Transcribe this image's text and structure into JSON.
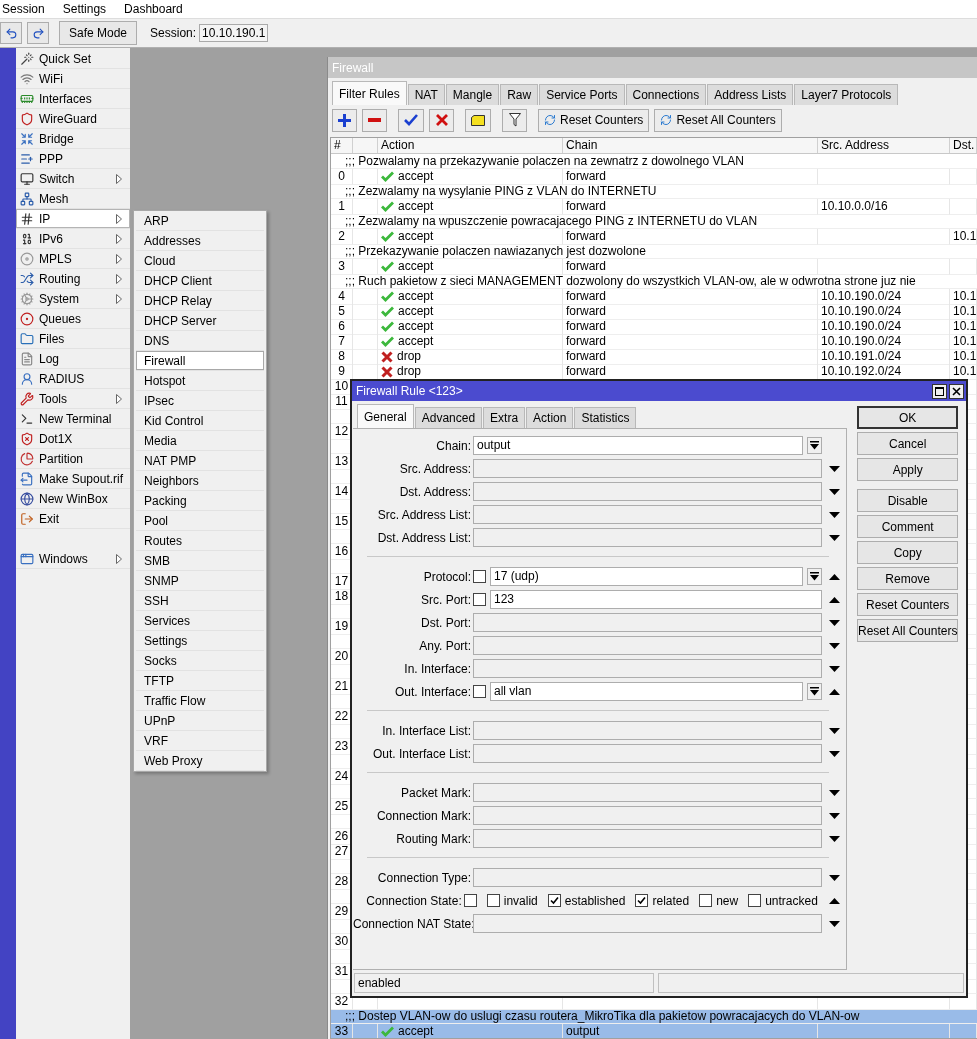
{
  "menu_bar": [
    "Session",
    "Settings",
    "Dashboard"
  ],
  "toolbar": {
    "safe_mode": "Safe Mode",
    "session_label": "Session:",
    "session_value": "10.10.190.1"
  },
  "sidebar": {
    "items": [
      {
        "label": "Quick Set",
        "submenu": false,
        "selected": false
      },
      {
        "label": "WiFi",
        "submenu": false,
        "selected": false
      },
      {
        "label": "Interfaces",
        "submenu": false,
        "selected": false
      },
      {
        "label": "WireGuard",
        "submenu": false,
        "selected": false
      },
      {
        "label": "Bridge",
        "submenu": false,
        "selected": false
      },
      {
        "label": "PPP",
        "submenu": false,
        "selected": false
      },
      {
        "label": "Switch",
        "submenu": true,
        "selected": false
      },
      {
        "label": "Mesh",
        "submenu": false,
        "selected": false
      },
      {
        "label": "IP",
        "submenu": true,
        "selected": true
      },
      {
        "label": "IPv6",
        "submenu": true,
        "selected": false
      },
      {
        "label": "MPLS",
        "submenu": true,
        "selected": false
      },
      {
        "label": "Routing",
        "submenu": true,
        "selected": false
      },
      {
        "label": "System",
        "submenu": true,
        "selected": false
      },
      {
        "label": "Queues",
        "submenu": false,
        "selected": false
      },
      {
        "label": "Files",
        "submenu": false,
        "selected": false
      },
      {
        "label": "Log",
        "submenu": false,
        "selected": false
      },
      {
        "label": "RADIUS",
        "submenu": false,
        "selected": false
      },
      {
        "label": "Tools",
        "submenu": true,
        "selected": false
      },
      {
        "label": "New Terminal",
        "submenu": false,
        "selected": false
      },
      {
        "label": "Dot1X",
        "submenu": false,
        "selected": false
      },
      {
        "label": "Partition",
        "submenu": false,
        "selected": false
      },
      {
        "label": "Make Supout.rif",
        "submenu": false,
        "selected": false
      },
      {
        "label": "New WinBox",
        "submenu": false,
        "selected": false
      },
      {
        "label": "Exit",
        "submenu": false,
        "selected": false
      }
    ],
    "windows_item": {
      "label": "Windows",
      "submenu": true,
      "selected": false
    }
  },
  "submenu": [
    {
      "label": "ARP",
      "selected": false
    },
    {
      "label": "Addresses",
      "selected": false
    },
    {
      "label": "Cloud",
      "selected": false
    },
    {
      "label": "DHCP Client",
      "selected": false
    },
    {
      "label": "DHCP Relay",
      "selected": false
    },
    {
      "label": "DHCP Server",
      "selected": false
    },
    {
      "label": "DNS",
      "selected": false
    },
    {
      "label": "Firewall",
      "selected": true
    },
    {
      "label": "Hotspot",
      "selected": false
    },
    {
      "label": "IPsec",
      "selected": false
    },
    {
      "label": "Kid Control",
      "selected": false
    },
    {
      "label": "Media",
      "selected": false
    },
    {
      "label": "NAT PMP",
      "selected": false
    },
    {
      "label": "Neighbors",
      "selected": false
    },
    {
      "label": "Packing",
      "selected": false
    },
    {
      "label": "Pool",
      "selected": false
    },
    {
      "label": "Routes",
      "selected": false
    },
    {
      "label": "SMB",
      "selected": false
    },
    {
      "label": "SNMP",
      "selected": false
    },
    {
      "label": "SSH",
      "selected": false
    },
    {
      "label": "Services",
      "selected": false
    },
    {
      "label": "Settings",
      "selected": false
    },
    {
      "label": "Socks",
      "selected": false
    },
    {
      "label": "TFTP",
      "selected": false
    },
    {
      "label": "Traffic Flow",
      "selected": false
    },
    {
      "label": "UPnP",
      "selected": false
    },
    {
      "label": "VRF",
      "selected": false
    },
    {
      "label": "Web Proxy",
      "selected": false
    }
  ],
  "firewall": {
    "title": "Firewall",
    "tabs": [
      {
        "label": "Filter Rules",
        "selected": true
      },
      {
        "label": "NAT",
        "selected": false
      },
      {
        "label": "Mangle",
        "selected": false
      },
      {
        "label": "Raw",
        "selected": false
      },
      {
        "label": "Service Ports",
        "selected": false
      },
      {
        "label": "Connections",
        "selected": false
      },
      {
        "label": "Address Lists",
        "selected": false
      },
      {
        "label": "Layer7 Protocols",
        "selected": false
      }
    ],
    "tools": [
      {
        "kind": "add"
      },
      {
        "kind": "remove"
      },
      {
        "kind": "enable"
      },
      {
        "kind": "disable"
      },
      {
        "kind": "comment"
      },
      {
        "kind": "filter"
      },
      {
        "kind": "reset",
        "label": "Reset Counters"
      },
      {
        "kind": "reset",
        "label": "Reset All Counters"
      }
    ],
    "columns": [
      "#",
      "Action",
      "Chain",
      "Src. Address",
      "Dst."
    ],
    "rows": [
      {
        "kind": "comment",
        "text": ";;; Pozwalamy na przekazywanie polaczen na zewnatrz z dowolnego VLAN",
        "selected": false
      },
      {
        "kind": "rule",
        "number": "0",
        "allowed": true,
        "action": "accept",
        "chain": "forward",
        "selected": false
      },
      {
        "kind": "comment",
        "text": ";;; Zezwalamy na wysylanie PING z VLAN do INTERNETU",
        "selected": false
      },
      {
        "kind": "rule",
        "number": "1",
        "allowed": true,
        "action": "accept",
        "chain": "forward",
        "src": "10.10.0.0/16",
        "selected": false
      },
      {
        "kind": "comment",
        "text": ";;; Zezwalamy na wpuszczenie powracajacego PING z INTERNETU do VLAN",
        "selected": false
      },
      {
        "kind": "rule",
        "number": "2",
        "allowed": true,
        "action": "accept",
        "chain": "forward",
        "dst": "10.1",
        "selected": false
      },
      {
        "kind": "comment",
        "text": ";;; Przekazywanie polaczen nawiazanych jest dozwolone",
        "selected": false
      },
      {
        "kind": "rule",
        "number": "3",
        "allowed": true,
        "action": "accept",
        "chain": "forward",
        "selected": false
      },
      {
        "kind": "comment",
        "text": ";;; Ruch pakietow z sieci MANAGEMENT dozwolony do wszystkich VLAN-ow, ale w odwrotna strone juz nie",
        "selected": false
      },
      {
        "kind": "rule",
        "number": "4",
        "allowed": true,
        "action": "accept",
        "chain": "forward",
        "src": "10.10.190.0/24",
        "dst": "10.1",
        "selected": false
      },
      {
        "kind": "rule",
        "number": "5",
        "allowed": true,
        "action": "accept",
        "chain": "forward",
        "src": "10.10.190.0/24",
        "dst": "10.1",
        "selected": false
      },
      {
        "kind": "rule",
        "number": "6",
        "allowed": true,
        "action": "accept",
        "chain": "forward",
        "src": "10.10.190.0/24",
        "dst": "10.1",
        "selected": false
      },
      {
        "kind": "rule",
        "number": "7",
        "allowed": true,
        "action": "accept",
        "chain": "forward",
        "src": "10.10.190.0/24",
        "dst": "10.1",
        "selected": false
      },
      {
        "kind": "rule",
        "number": "8",
        "allowed": false,
        "action": "drop",
        "chain": "forward",
        "src": "10.10.191.0/24",
        "dst": "10.1",
        "selected": false
      },
      {
        "kind": "rule",
        "number": "9",
        "allowed": false,
        "action": "drop",
        "chain": "forward",
        "src": "10.10.192.0/24",
        "dst": "10.1",
        "selected": false
      },
      {
        "kind": "rule",
        "number": "10",
        "selected": false
      },
      {
        "kind": "rule",
        "number": "11",
        "selected": false
      },
      {
        "kind": "gap",
        "selected": false
      },
      {
        "kind": "rule",
        "number": "12",
        "selected": false
      },
      {
        "kind": "gap",
        "selected": false
      },
      {
        "kind": "rule",
        "number": "13",
        "selected": false
      },
      {
        "kind": "gap",
        "selected": false
      },
      {
        "kind": "rule",
        "number": "14",
        "selected": false
      },
      {
        "kind": "gap",
        "selected": false
      },
      {
        "kind": "rule",
        "number": "15",
        "selected": false
      },
      {
        "kind": "gap",
        "selected": false
      },
      {
        "kind": "rule",
        "number": "16",
        "selected": false
      },
      {
        "kind": "gap",
        "selected": false
      },
      {
        "kind": "rule",
        "number": "17",
        "selected": false
      },
      {
        "kind": "rule",
        "number": "18",
        "selected": false
      },
      {
        "kind": "gap",
        "selected": false
      },
      {
        "kind": "rule",
        "number": "19",
        "selected": false
      },
      {
        "kind": "gap",
        "selected": false
      },
      {
        "kind": "rule",
        "number": "20",
        "selected": false
      },
      {
        "kind": "gap",
        "selected": false
      },
      {
        "kind": "rule",
        "number": "21",
        "selected": false
      },
      {
        "kind": "gap",
        "selected": false
      },
      {
        "kind": "rule",
        "number": "22",
        "selected": false
      },
      {
        "kind": "gap",
        "selected": false
      },
      {
        "kind": "rule",
        "number": "23",
        "selected": false
      },
      {
        "kind": "gap",
        "selected": false
      },
      {
        "kind": "rule",
        "number": "24",
        "selected": false
      },
      {
        "kind": "gap",
        "selected": false
      },
      {
        "kind": "rule",
        "number": "25",
        "selected": false
      },
      {
        "kind": "gap",
        "selected": false
      },
      {
        "kind": "rule",
        "number": "26",
        "selected": false
      },
      {
        "kind": "rule",
        "number": "27",
        "selected": false
      },
      {
        "kind": "gap",
        "selected": false
      },
      {
        "kind": "rule",
        "number": "28",
        "selected": false
      },
      {
        "kind": "gap",
        "selected": false
      },
      {
        "kind": "rule",
        "number": "29",
        "selected": false
      },
      {
        "kind": "gap",
        "selected": false
      },
      {
        "kind": "rule",
        "number": "30",
        "selected": false
      },
      {
        "kind": "gap",
        "selected": false
      },
      {
        "kind": "rule",
        "number": "31",
        "selected": false
      },
      {
        "kind": "gap",
        "selected": false
      },
      {
        "kind": "rule",
        "number": "32",
        "selected": false
      },
      {
        "kind": "comment",
        "text": ";;; Dostep VLAN-ow do uslugi czasu routera_MikroTika dla pakietow powracajacych do VLAN-ow",
        "selected": true
      },
      {
        "kind": "rule",
        "number": "33",
        "allowed": true,
        "action": "accept",
        "chain": "output",
        "selected": true
      }
    ]
  },
  "dialog": {
    "title": "Firewall Rule <123>",
    "tabs": [
      {
        "label": "General",
        "selected": true
      },
      {
        "label": "Advanced",
        "selected": false
      },
      {
        "label": "Extra",
        "selected": false
      },
      {
        "label": "Action",
        "selected": false
      },
      {
        "label": "Statistics",
        "selected": false
      }
    ],
    "form": [
      {
        "kind": "field",
        "label": "Chain:",
        "value": "output",
        "combo": true
      },
      {
        "kind": "field",
        "label": "Src. Address:",
        "combo": false,
        "expanded": false
      },
      {
        "kind": "field",
        "label": "Dst. Address:",
        "combo": false,
        "expanded": false
      },
      {
        "kind": "field",
        "label": "Src. Address List:",
        "combo": false,
        "expanded": false
      },
      {
        "kind": "field",
        "label": "Dst. Address List:",
        "combo": false,
        "expanded": false
      },
      {
        "kind": "divider"
      },
      {
        "kind": "field",
        "label": "Protocol:",
        "negate": false,
        "value": "17 (udp)",
        "combo": true,
        "expanded": true
      },
      {
        "kind": "field",
        "label": "Src. Port:",
        "negate": false,
        "value": "123",
        "combo": false,
        "expanded": true
      },
      {
        "kind": "field",
        "label": "Dst. Port:",
        "combo": false,
        "expanded": false
      },
      {
        "kind": "field",
        "label": "Any. Port:",
        "combo": false,
        "expanded": false
      },
      {
        "kind": "field",
        "label": "In. Interface:",
        "combo": false,
        "expanded": false
      },
      {
        "kind": "field",
        "label": "Out. Interface:",
        "negate": false,
        "value": "all vlan",
        "combo": true,
        "expanded": true
      },
      {
        "kind": "divider"
      },
      {
        "kind": "field",
        "label": "In. Interface List:",
        "combo": false,
        "expanded": false
      },
      {
        "kind": "field",
        "label": "Out. Interface List:",
        "combo": false,
        "expanded": false
      },
      {
        "kind": "divider"
      },
      {
        "kind": "field",
        "label": "Packet Mark:",
        "combo": false,
        "expanded": false
      },
      {
        "kind": "field",
        "label": "Connection Mark:",
        "combo": false,
        "expanded": false
      },
      {
        "kind": "field",
        "label": "Routing Mark:",
        "combo": false,
        "expanded": false
      },
      {
        "kind": "divider"
      },
      {
        "kind": "field",
        "label": "Connection Type:",
        "combo": false,
        "expanded": false
      },
      {
        "kind": "states",
        "label": "Connection State:",
        "negate": false,
        "expanded": true,
        "options": [
          {
            "label": "invalid",
            "checked": false
          },
          {
            "label": "established",
            "checked": true
          },
          {
            "label": "related",
            "checked": true
          },
          {
            "label": "new",
            "checked": false
          },
          {
            "label": "untracked",
            "checked": false
          }
        ]
      },
      {
        "kind": "field",
        "label": "Connection NAT State:",
        "combo": false,
        "expanded": false
      }
    ],
    "button_groups": [
      [
        {
          "label": "OK",
          "default": true
        },
        {
          "label": "Cancel",
          "default": false
        },
        {
          "label": "Apply",
          "default": false
        }
      ],
      [
        {
          "label": "Disable",
          "default": false
        },
        {
          "label": "Comment",
          "default": false
        },
        {
          "label": "Copy",
          "default": false
        },
        {
          "label": "Remove",
          "default": false
        },
        {
          "label": "Reset Counters",
          "default": false
        },
        {
          "label": "Reset All Counters",
          "default": false
        }
      ]
    ],
    "status": "enabled"
  }
}
